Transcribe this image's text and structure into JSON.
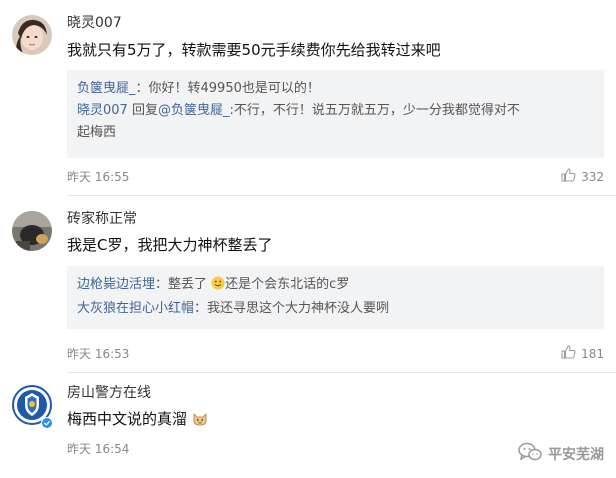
{
  "comments": [
    {
      "username": "晓灵007",
      "content": "我就只有5万了，转款需要50元手续费你先给我转过来吧",
      "replies": [
        {
          "user": "负箧曳屣_",
          "text": "：你好！转49950也是可以的！"
        },
        {
          "user": "晓灵007",
          "mid": " 回复",
          "mention": "@负箧曳屣_",
          "text": ":不行，不行！说五万就五万，少一分我都觉得对不",
          "text2": "起梅西"
        }
      ],
      "time": "昨天 16:55",
      "likes": "332"
    },
    {
      "username": "砖家称正常",
      "content": "我是C罗，我把大力神杯整丢了",
      "replies": [
        {
          "user": "边枪毙边活埋",
          "text": "：整丢了",
          "text_after_emoji": "还是个会东北话的c罗"
        },
        {
          "user": "大灰狼在担心小红帽",
          "text": "：我还寻思这个大力神杯没人要咧"
        }
      ],
      "time": "昨天 16:53",
      "likes": "181"
    },
    {
      "username": "房山警方在线",
      "content": "梅西中文说的真溜",
      "time": "昨天 16:54"
    }
  ],
  "watermark": {
    "text": "平安芜湖"
  },
  "icons": {
    "like": "thumbs-up-icon",
    "emoji_smile": "smile-emoji-icon",
    "emoji_cat": "cat-emoji-icon",
    "verified": "verified-badge-icon",
    "wechat": "wechat-icon"
  },
  "colors": {
    "link_blue": "#406599",
    "reply_bg": "#f2f3f5",
    "time_gray": "#888888"
  }
}
